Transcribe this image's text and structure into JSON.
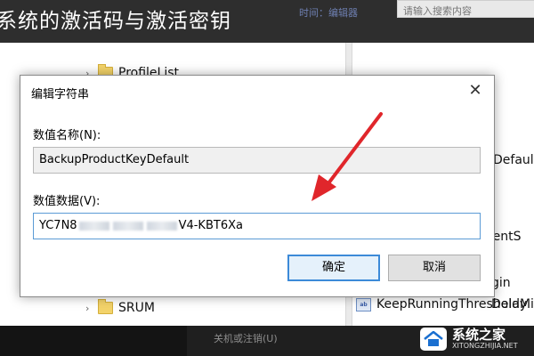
{
  "banner": {
    "title": "系统的激活码与激活密钥",
    "meta": "时间：编辑器",
    "search_placeholder": "请输入搜索内容"
  },
  "registry": {
    "tree_items": [
      "ProfileList",
      "SRUM"
    ],
    "values": [
      "Defaul",
      "rs",
      "mentS",
      "gin",
      "Delay",
      "KeepRunningThresholdMi"
    ]
  },
  "dialog": {
    "title": "编辑字符串",
    "close_glyph": "✕",
    "name_label": "数值名称(N):",
    "name_value": "BackupProductKeyDefault",
    "data_label": "数值数据(V):",
    "data_value_start": "YC7N8",
    "data_value_end": "V4-KBT6Xa",
    "ok_label": "确定",
    "cancel_label": "取消"
  },
  "bottom": {
    "power_item": "关机或注销(U)",
    "watermark_cn": "系统之家",
    "watermark_en": "XITONGZHIJIA.NET"
  },
  "colors": {
    "accent_blue": "#3c8ad8",
    "arrow_red": "#e0262b"
  }
}
